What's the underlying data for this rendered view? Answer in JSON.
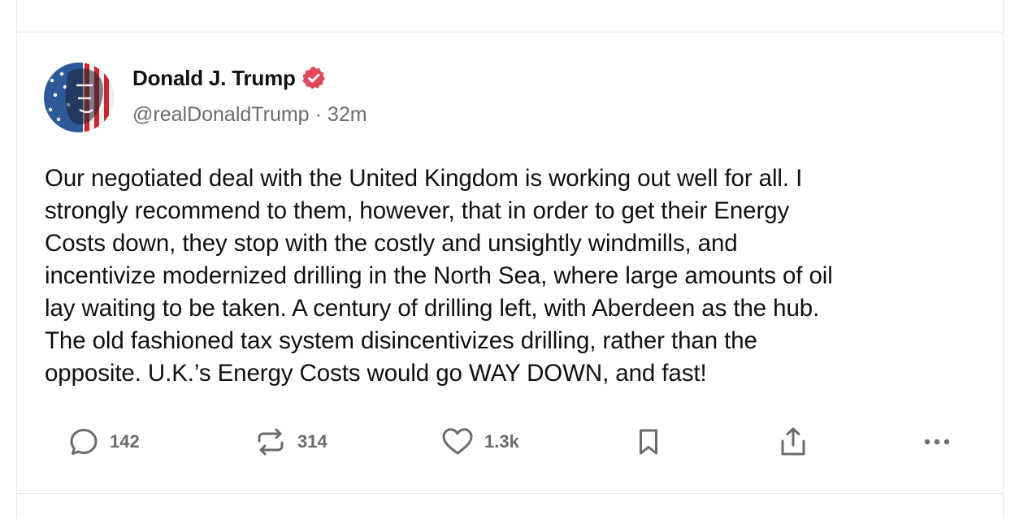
{
  "post": {
    "author": {
      "display_name": "Donald J. Trump",
      "handle": "@realDonaldTrump",
      "verified_icon": "verified-badge-icon",
      "verified_color": "#e0475a"
    },
    "separator": "·",
    "timestamp": "32m",
    "body_lines": [
      "Our negotiated deal with the United Kingdom is working out well for all. I",
      "strongly recommend to them, however, that in order to get their Energy",
      "Costs down, they stop with the costly and unsightly windmills, and",
      "incentivize modernized drilling in the North Sea, where large amounts of oil",
      "lay waiting to be taken. A century of drilling left, with Aberdeen as the hub.",
      "The old fashioned tax system disincentivizes drilling, rather than the",
      "opposite. U.K.’s Energy Costs would go WAY DOWN, and fast!"
    ],
    "actions": {
      "reply": {
        "icon": "reply-icon",
        "count": "142"
      },
      "retruth": {
        "icon": "retruth-icon",
        "count": "314"
      },
      "like": {
        "icon": "heart-icon",
        "count": "1.3k"
      },
      "bookmark": {
        "icon": "bookmark-icon"
      },
      "share": {
        "icon": "share-icon"
      },
      "more": {
        "icon": "more-icon"
      }
    }
  },
  "colors": {
    "text_primary": "#111111",
    "text_secondary": "#6b6b70",
    "divider": "#e6e6e6"
  }
}
